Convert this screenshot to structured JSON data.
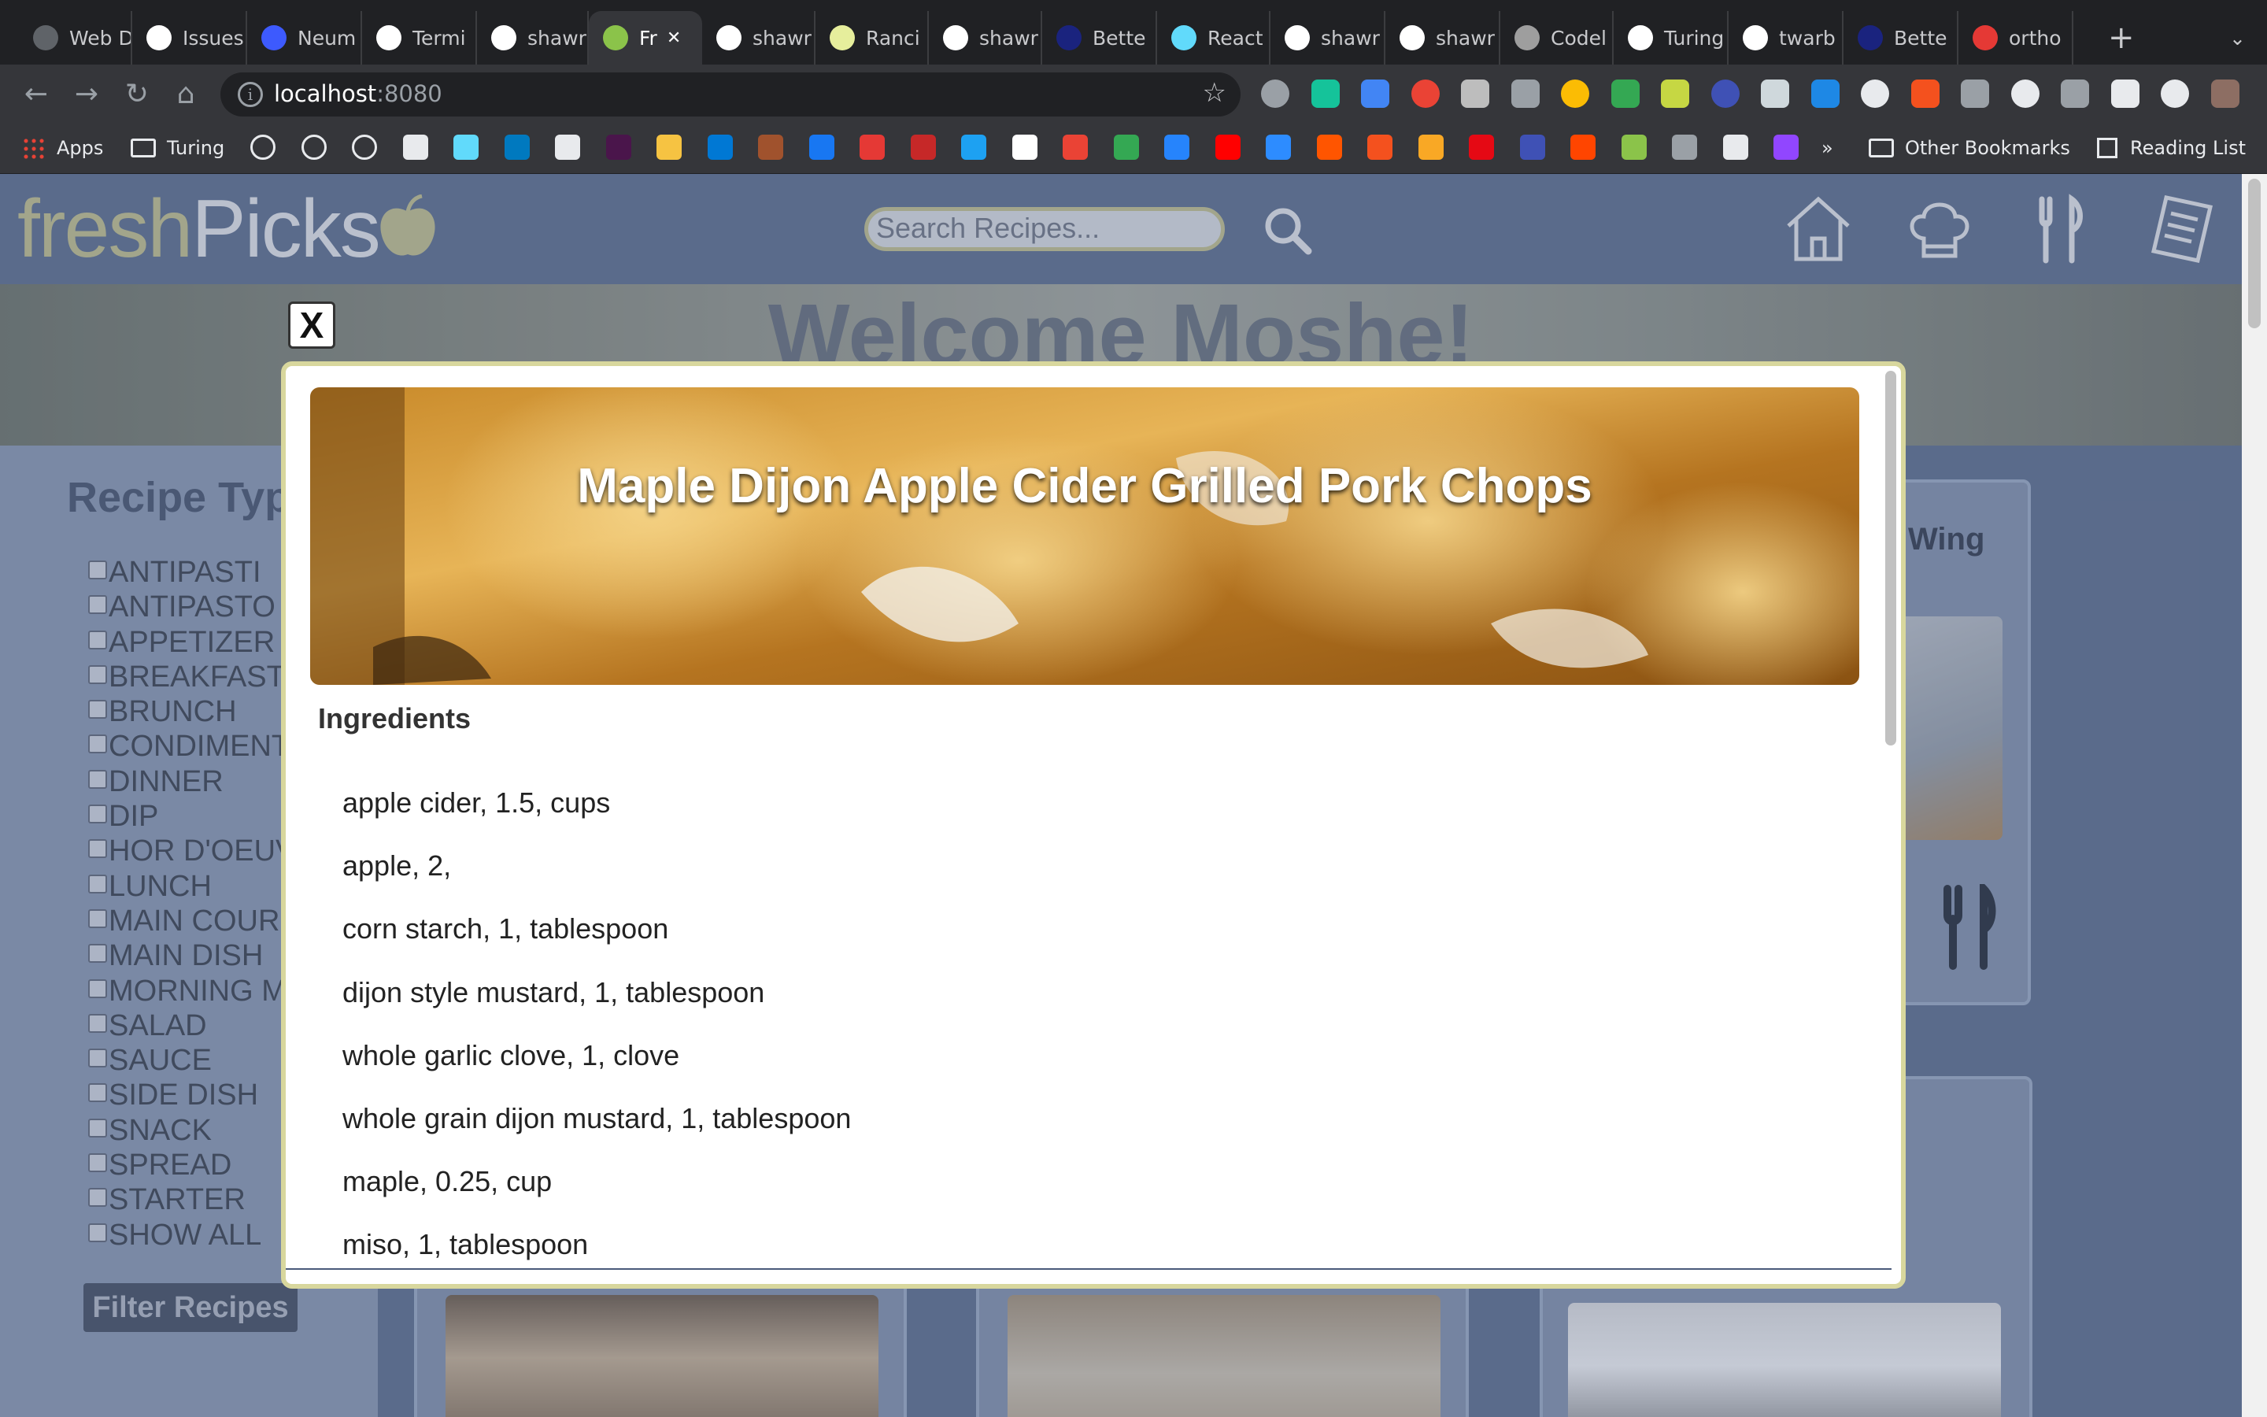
{
  "browser": {
    "tabs": [
      {
        "label": "Web D",
        "icon": "generic-site-icon",
        "color": "#5f6368"
      },
      {
        "label": "Issues",
        "icon": "github-icon",
        "color": "#ffffff"
      },
      {
        "label": "Neum",
        "icon": "neumorphism-icon",
        "color": "#3d5afe"
      },
      {
        "label": "Termi",
        "icon": "terminal-icon",
        "color": "#ffffff"
      },
      {
        "label": "shawr",
        "icon": "github-icon",
        "color": "#ffffff"
      },
      {
        "label": "Fr",
        "icon": "apple-icon",
        "color": "#8bc34a"
      },
      {
        "label": "shawr",
        "icon": "github-icon",
        "color": "#ffffff"
      },
      {
        "label": "Ranci",
        "icon": "rancid-tomatillos-icon",
        "color": "#e6ee9c"
      },
      {
        "label": "shawr",
        "icon": "github-icon",
        "color": "#ffffff"
      },
      {
        "label": "Bette",
        "icon": "better-programming-icon",
        "color": "#1a237e"
      },
      {
        "label": "React",
        "icon": "react-icon",
        "color": "#61dafb"
      },
      {
        "label": "shawr",
        "icon": "github-icon",
        "color": "#ffffff"
      },
      {
        "label": "shawr",
        "icon": "github-icon",
        "color": "#ffffff"
      },
      {
        "label": "Codel",
        "icon": "codelab-icon",
        "color": "#9e9e9e"
      },
      {
        "label": "Turing",
        "icon": "github-icon",
        "color": "#ffffff"
      },
      {
        "label": "twarb",
        "icon": "github-icon",
        "color": "#ffffff"
      },
      {
        "label": "Bette",
        "icon": "better-programming-icon",
        "color": "#1a237e"
      },
      {
        "label": "ortho",
        "icon": "ortho-icon",
        "color": "#e53935"
      }
    ],
    "active_tab_index": 5,
    "url_host": "localhost",
    "url_port": ":8080",
    "bookmarks": {
      "apps": "Apps",
      "turing": "Turing",
      "overflow": "»",
      "other": "Other Bookmarks",
      "reading_list": "Reading List"
    }
  },
  "app": {
    "logo_fresh": "fresh",
    "logo_picks": "Picks",
    "search_placeholder": "Search Recipes...",
    "welcome": "Welcome  Moshe!",
    "sidebar_title": "Recipe Types",
    "filters": [
      "ANTIPASTI",
      "ANTIPASTO",
      "APPETIZER",
      "BREAKFAST",
      "BRUNCH",
      "CONDIMENT",
      "DINNER",
      "DIP",
      "HOR D'OEUVRE",
      "LUNCH",
      "MAIN COURSE",
      "MAIN DISH",
      "MORNING MEAL",
      "SALAD",
      "SAUCE",
      "SIDE DISH",
      "SNACK",
      "SPREAD",
      "STARTER",
      "SHOW ALL"
    ],
    "filter_button": "Filter Recipes",
    "partial_card_title": "Wing",
    "colors": {
      "accent": "#c9c78e",
      "header": "#5b6d8e",
      "sidebar": "#8d9bb5"
    }
  },
  "modal": {
    "close_label": "X",
    "recipe_title": "Maple Dijon Apple Cider Grilled Pork Chops",
    "ingredients_heading": "Ingredients",
    "ingredients": [
      "apple cider, 1.5, cups",
      "apple, 2,",
      "corn starch, 1, tablespoon",
      "dijon style mustard, 1, tablespoon",
      "whole garlic clove, 1, clove",
      "whole grain dijon mustard, 1, tablespoon",
      "maple, 0.25, cup",
      "miso, 1, tablespoon"
    ]
  }
}
